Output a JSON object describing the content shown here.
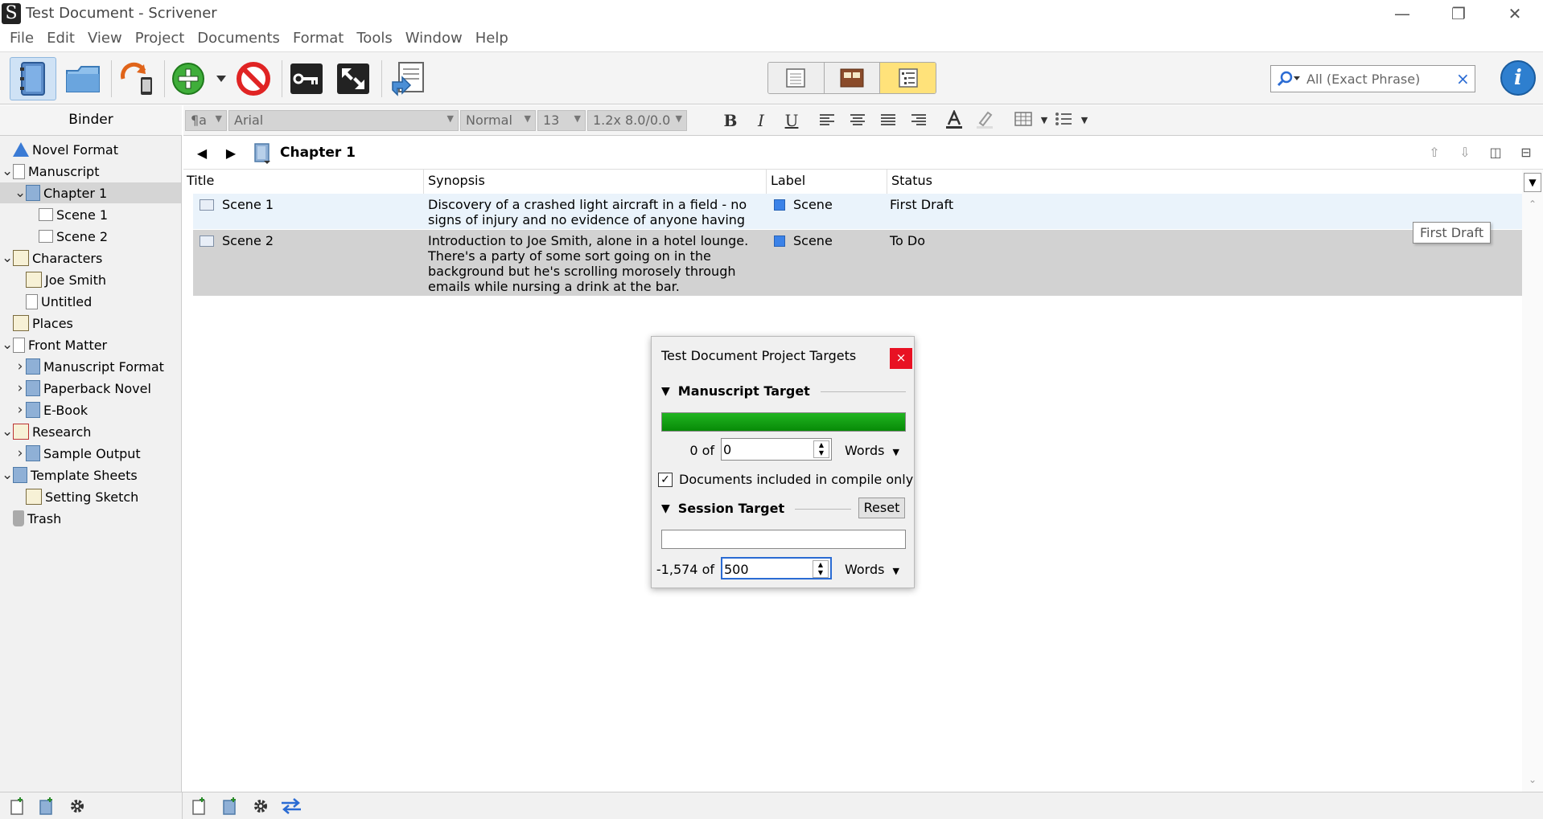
{
  "window": {
    "title": "Test Document - Scrivener",
    "app_icon_letter": "S",
    "minimize": "—",
    "restore": "❐",
    "close": "✕"
  },
  "menu": [
    "File",
    "Edit",
    "View",
    "Project",
    "Documents",
    "Format",
    "Tools",
    "Window",
    "Help"
  ],
  "search": {
    "value": "All (Exact Phrase)",
    "clear": "×"
  },
  "info_label": "i",
  "binder": {
    "header": "Binder",
    "items": [
      {
        "label": "Novel Format",
        "icon": "warning-icon",
        "depth": 0,
        "twist": ""
      },
      {
        "label": "Manuscript",
        "icon": "manuscript-icon",
        "depth": 0,
        "twist": "v"
      },
      {
        "label": "Chapter 1",
        "icon": "folder-icon",
        "depth": 1,
        "twist": "v",
        "selected": true
      },
      {
        "label": "Scene 1",
        "icon": "text-icon",
        "depth": 2,
        "twist": ""
      },
      {
        "label": "Scene 2",
        "icon": "text-icon",
        "depth": 2,
        "twist": ""
      },
      {
        "label": "Characters",
        "icon": "character-icon",
        "depth": 0,
        "twist": "v"
      },
      {
        "label": "Joe Smith",
        "icon": "character-sheet-icon",
        "depth": 1,
        "twist": ""
      },
      {
        "label": "Untitled",
        "icon": "document-icon",
        "depth": 1,
        "twist": ""
      },
      {
        "label": "Places",
        "icon": "places-icon",
        "depth": 0,
        "twist": ""
      },
      {
        "label": "Front Matter",
        "icon": "front-matter-icon",
        "depth": 0,
        "twist": "v"
      },
      {
        "label": "Manuscript Format",
        "icon": "folder-icon",
        "depth": 1,
        "twist": ">"
      },
      {
        "label": "Paperback Novel",
        "icon": "folder-icon",
        "depth": 1,
        "twist": ">"
      },
      {
        "label": "E-Book",
        "icon": "folder-icon",
        "depth": 1,
        "twist": ">"
      },
      {
        "label": "Research",
        "icon": "research-icon",
        "depth": 0,
        "twist": "v"
      },
      {
        "label": "Sample Output",
        "icon": "folder-icon",
        "depth": 1,
        "twist": ">"
      },
      {
        "label": "Template Sheets",
        "icon": "template-icon",
        "depth": 0,
        "twist": "v"
      },
      {
        "label": "Setting Sketch",
        "icon": "setting-sketch-icon",
        "depth": 1,
        "twist": ""
      },
      {
        "label": "Trash",
        "icon": "trash-icon",
        "depth": 0,
        "twist": ""
      }
    ]
  },
  "formatbar": {
    "style": "¶a",
    "font": "Arial",
    "typeface": "Normal",
    "size": "13",
    "spacing": "1.2x 8.0/0.0",
    "bold": "B",
    "italic": "I",
    "underline": "U"
  },
  "editor": {
    "back": "◀",
    "forward": "▶",
    "title": "Chapter 1"
  },
  "outline": {
    "columns": {
      "title": "Title",
      "synopsis": "Synopsis",
      "label": "Label",
      "status": "Status"
    },
    "rows": [
      {
        "title": "Scene 1",
        "synopsis": "Discovery of a crashed light aircraft in a field - no signs of injury and no evidence of anyone having been on board.",
        "label": "Scene",
        "status": "First Draft"
      },
      {
        "title": "Scene 2",
        "synopsis": "Introduction to Joe Smith, alone in a hotel lounge. There's a party of some sort going on in the background but he's scrolling morosely through emails while nursing a drink at the bar.",
        "label": "Scene",
        "status": "To Do"
      }
    ],
    "tooltip": "First Draft"
  },
  "dialog": {
    "title": "Test Document Project Targets",
    "close": "×",
    "manuscript": {
      "heading": "Manuscript Target",
      "progress": 1.0,
      "count": "0 of",
      "target": "0",
      "unit": "Words"
    },
    "compile_only": {
      "label": "Documents included in compile only",
      "checked": true,
      "mark": "✓"
    },
    "session": {
      "heading": "Session Target",
      "reset": "Reset",
      "progress": 0.0,
      "count": "-1,574 of",
      "target": "500",
      "unit": "Words"
    }
  },
  "colors": {
    "accent": "#2e7fcf",
    "progress_green": "#0f9e0f",
    "label_blue": "#3b82e8",
    "selection_row": "#d2d2d2",
    "highlight_row": "#eaf3fb",
    "close_red": "#e81123"
  }
}
